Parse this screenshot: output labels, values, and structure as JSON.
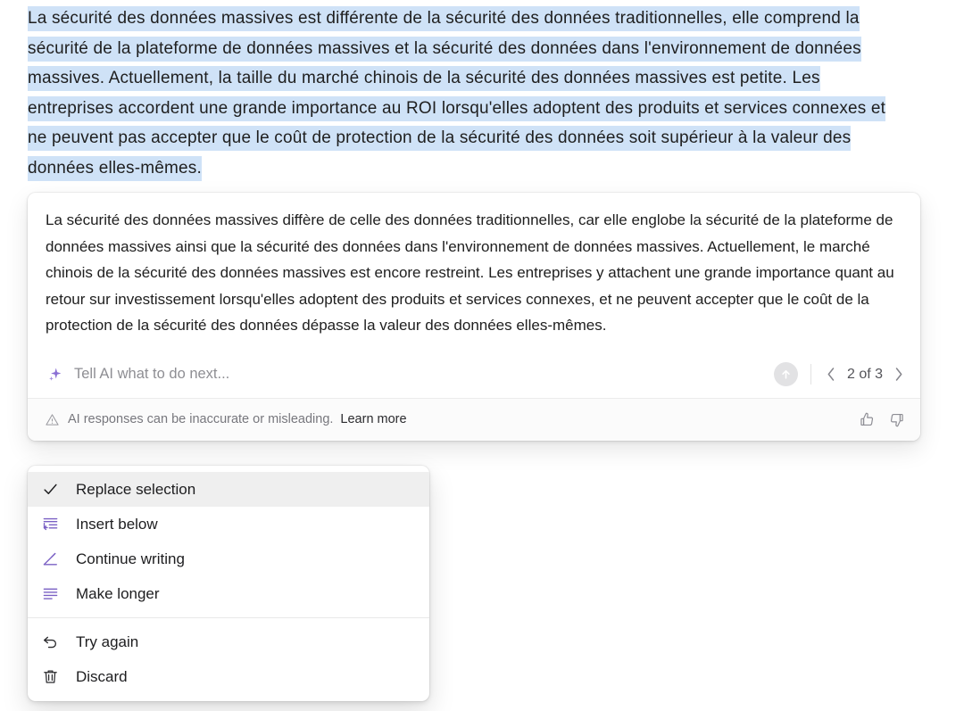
{
  "source_paragraph": {
    "text": "La sécurité des données massives est différente de la sécurité des données traditionnelles, elle comprend la sécurité de la plateforme de données massives et la sécurité des données dans l'environnement de données massives. Actuellement, la taille du marché chinois de la sécurité des données massives est petite. Les entreprises accordent une grande importance au ROI lorsqu'elles adoptent des produits et services connexes et ne peuvent pas accepter que le coût de protection de la sécurité des données soit supérieur à la valeur des données elles-mêmes.",
    "selection_highlight_color": "#cfe2f7"
  },
  "ai_card": {
    "response_text": "La sécurité des données massives diffère de celle des données traditionnelles, car elle englobe la sécurité de la plateforme de données massives ainsi que la sécurité des données dans l'environnement de données massives. Actuellement, le marché chinois de la sécurité des données massives est encore restreint. Les entreprises y attachent une grande importance quant au retour sur investissement lorsqu'elles adoptent des produits et services connexes, et ne peuvent accepter que le coût de la protection de la sécurité des données dépasse la valeur des données elles-mêmes.",
    "prompt": {
      "icon": "sparkle-icon",
      "icon_color": "#8a6fd4",
      "value": "",
      "placeholder": "Tell AI what to do next...",
      "send_icon": "arrow-up-circle-icon"
    },
    "pager": {
      "prev_icon": "chevron-left-icon",
      "label": "2 of 3",
      "next_icon": "chevron-right-icon",
      "current": 2,
      "total": 3
    },
    "footer": {
      "warning_icon": "warning-triangle-icon",
      "disclaimer": "AI responses can be inaccurate or misleading.",
      "learn_more": "Learn more",
      "thumbs_up_icon": "thumbs-up-icon",
      "thumbs_down_icon": "thumbs-down-icon"
    }
  },
  "action_menu": {
    "groups": [
      {
        "items": [
          {
            "label": "Replace selection",
            "icon": "check-icon",
            "icon_color": "#1d1d1f",
            "active": true
          },
          {
            "label": "Insert below",
            "icon": "insert-below-icon",
            "icon_color": "#7a60c4",
            "active": false
          },
          {
            "label": "Continue writing",
            "icon": "pencil-line-icon",
            "icon_color": "#7a60c4",
            "active": false
          },
          {
            "label": "Make longer",
            "icon": "make-longer-icon",
            "icon_color": "#7a60c4",
            "active": false
          }
        ]
      },
      {
        "items": [
          {
            "label": "Try again",
            "icon": "undo-arrow-icon",
            "icon_color": "#2b2b2e",
            "active": false
          },
          {
            "label": "Discard",
            "icon": "trash-icon",
            "icon_color": "#2b2b2e",
            "active": false
          }
        ]
      }
    ]
  }
}
